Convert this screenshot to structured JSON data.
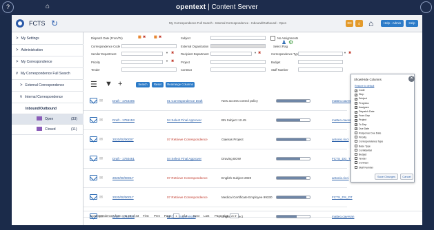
{
  "app": {
    "brand": "opentext",
    "product": "Content Server",
    "name": "FCTS",
    "breadcrumb": "My Correspondence Full Search - Internal Correspondence - Inbound/Outbound - Open",
    "help_admin": "Help - Admin",
    "help": "Help"
  },
  "sidebar": {
    "items": [
      {
        "label": "My Settings",
        "chev": ">"
      },
      {
        "label": "Administration",
        "chev": ">"
      },
      {
        "label": "My Correspondence",
        "chev": ">"
      },
      {
        "label": "My Correspondence Full Search",
        "chev": "v"
      },
      {
        "label": "External Correspondence",
        "chev": ">"
      },
      {
        "label": "Internal Correspondence",
        "chev": "v"
      },
      {
        "label": "Inbound/Outbound",
        "chev": ""
      },
      {
        "label": "Open",
        "count": "(33)"
      },
      {
        "label": "Closed",
        "count": "(11)"
      }
    ]
  },
  "filters": {
    "dispatch_date": "Dispatch Date (From/To)",
    "subject": "Subject",
    "no_assignments": "No Assignments",
    "correspondence_code": "Correspondence Code",
    "external_org": "External Organization",
    "select_flag": "Select Flag",
    "sender_dept": "Sender Department",
    "recipient_dept": "Recipient Department",
    "corr_type": "Correspondence Type",
    "priority": "Priority",
    "project": "Project",
    "budget": "Budget",
    "tender": "Tender",
    "contract": "Contract",
    "staff_number": "Staff Number"
  },
  "actions": {
    "search": "Search",
    "reset": "Reset",
    "rearrange": "Rearrange Columns"
  },
  "rows": [
    {
      "status": "Draft - 1754405",
      "step": "01 Correspondence Draft",
      "subject": "New access control policy",
      "progress": 0.9,
      "user": "matteo.cavesan"
    },
    {
      "status": "Draft - 1755153",
      "step": "04 Select Final Approver",
      "subject": "BN Subject 12.45",
      "progress": 0.7,
      "user": "matteo.cavesan"
    },
    {
      "status": "2020/00/00007",
      "step": "07 Retrieve Correspondence",
      "subject": "Gaieras Project",
      "progress": 0.9,
      "user": "antonio.ricci"
    },
    {
      "status": "Draft - 1760461",
      "step": "04 Select Final Approver",
      "subject": "Draving BOW",
      "progress": 0.7,
      "user": "FCTS_DG_T4"
    },
    {
      "status": "2020/00/00017",
      "step": "07 Retrieve Correspondence",
      "subject": "English Subject 2020",
      "progress": 0.9,
      "user": "antonio.ricci"
    },
    {
      "status": "2020/00/00017",
      "step": "07 Retrieve Correspondence",
      "subject": "Medical Certificate Employee 99330",
      "progress": 0.9,
      "user": "FCTS_DS_DT"
    },
    {
      "status": "Draft - 1751405",
      "step": "01 Draft Supervision",
      "subject": "English subject",
      "progress": 0.6,
      "user": "matteo.cavesan"
    },
    {
      "status": "Draft - 1751003",
      "step": "04 Select Final Approver",
      "subject": "english subject",
      "progress": 0.6,
      "user": "matteo.cavesan"
    }
  ],
  "columns_panel": {
    "title": "Show/Hide Columns",
    "restore": "Restore to default",
    "options": [
      {
        "label": "Code",
        "checked": true
      },
      {
        "label": "Step",
        "checked": true
      },
      {
        "label": "Subject",
        "checked": true
      },
      {
        "label": "Progress",
        "checked": true
      },
      {
        "label": "Assignee",
        "checked": true
      },
      {
        "label": "Dispatch Date",
        "checked": true
      },
      {
        "label": "From Dep",
        "checked": true
      },
      {
        "label": "Project",
        "checked": true
      },
      {
        "label": "To Dep",
        "checked": true
      },
      {
        "label": "Due Date",
        "checked": true
      },
      {
        "label": "Response Due Date",
        "checked": false
      },
      {
        "label": "Priority",
        "checked": false
      },
      {
        "label": "Correspondence Type",
        "checked": false
      },
      {
        "label": "Base Type",
        "checked": false
      },
      {
        "label": "Confidential",
        "checked": false
      },
      {
        "label": "Budget",
        "checked": false
      },
      {
        "label": "Tender",
        "checked": false
      },
      {
        "label": "Contract",
        "checked": false
      },
      {
        "label": "Staff Number",
        "checked": false
      }
    ],
    "save": "Save Changes",
    "cancel": "Cancel"
  },
  "footer": {
    "summary": "Correspondences from 1 to 20 of 33",
    "first": "First",
    "prev": "Prev",
    "page_label": "Page",
    "page_value": "1",
    "of": "of 2",
    "next": "Next",
    "last": "Last",
    "page_size_label": "Page Size",
    "page_size_value": "20"
  }
}
